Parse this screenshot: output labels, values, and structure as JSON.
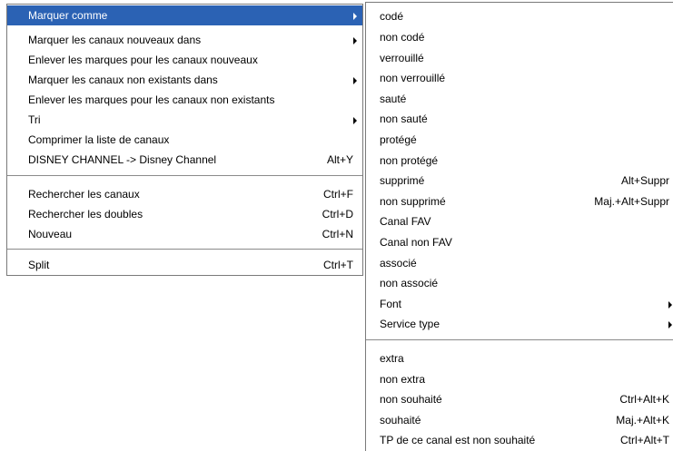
{
  "colors": {
    "selection_background": "#2b62b4",
    "selection_text": "#ffffff",
    "menu_background": "#ffffff",
    "separator": "#8a8a8a"
  },
  "main_menu": {
    "items": [
      {
        "label": "Marquer comme",
        "shortcut": "",
        "submenu": true,
        "selected": true
      },
      {
        "label": "Marquer les canaux nouveaux dans",
        "shortcut": "",
        "submenu": true
      },
      {
        "label": "Enlever les marques pour les canaux nouveaux",
        "shortcut": ""
      },
      {
        "label": "Marquer les canaux non existants dans",
        "shortcut": "",
        "submenu": true
      },
      {
        "label": "Enlever les marques pour les canaux non existants",
        "shortcut": ""
      },
      {
        "label": "Tri",
        "shortcut": "",
        "submenu": true
      },
      {
        "label": "Comprimer la liste de canaux",
        "shortcut": ""
      },
      {
        "label": "DISNEY CHANNEL -> Disney Channel",
        "shortcut": "Alt+Y"
      },
      {
        "label": "Rechercher les canaux",
        "shortcut": "Ctrl+F"
      },
      {
        "label": "Rechercher les doubles",
        "shortcut": "Ctrl+D"
      },
      {
        "label": "Nouveau",
        "shortcut": "Ctrl+N"
      },
      {
        "label": "Split",
        "shortcut": "Ctrl+T"
      }
    ]
  },
  "submenu": {
    "items": [
      {
        "label": "codé",
        "shortcut": ""
      },
      {
        "label": "non codé",
        "shortcut": ""
      },
      {
        "label": "verrouillé",
        "shortcut": ""
      },
      {
        "label": "non verrouillé",
        "shortcut": ""
      },
      {
        "label": "sauté",
        "shortcut": ""
      },
      {
        "label": "non sauté",
        "shortcut": ""
      },
      {
        "label": "protégé",
        "shortcut": ""
      },
      {
        "label": "non protégé",
        "shortcut": ""
      },
      {
        "label": "supprimé",
        "shortcut": "Alt+Suppr"
      },
      {
        "label": "non supprimé",
        "shortcut": "Maj.+Alt+Suppr"
      },
      {
        "label": "Canal FAV",
        "shortcut": ""
      },
      {
        "label": "Canal non FAV",
        "shortcut": ""
      },
      {
        "label": "associé",
        "shortcut": ""
      },
      {
        "label": "non associé",
        "shortcut": ""
      },
      {
        "label": "Font",
        "shortcut": "",
        "submenu": true
      },
      {
        "label": "Service type",
        "shortcut": "",
        "submenu": true
      },
      {
        "label": "extra",
        "shortcut": ""
      },
      {
        "label": "non extra",
        "shortcut": ""
      },
      {
        "label": "non souhaité",
        "shortcut": "Ctrl+Alt+K"
      },
      {
        "label": "souhaité",
        "shortcut": "Maj.+Alt+K"
      },
      {
        "label": "TP de ce canal est non souhaité",
        "shortcut": "Ctrl+Alt+T"
      }
    ]
  }
}
